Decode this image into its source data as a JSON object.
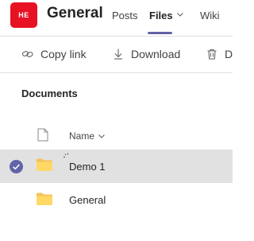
{
  "header": {
    "team_avatar_initials": "HE",
    "team_avatar_color": "#e81123",
    "channel_title": "General",
    "tabs": [
      {
        "label": "Posts",
        "active": false
      },
      {
        "label": "Files",
        "active": true,
        "has_dropdown": true
      },
      {
        "label": "Wiki",
        "active": false
      }
    ],
    "accent_color": "#6264a7"
  },
  "toolbar": {
    "copy_link": {
      "label": "Copy link",
      "icon": "link-icon"
    },
    "download": {
      "label": "Download",
      "icon": "download-icon"
    },
    "delete": {
      "label": "D",
      "icon": "trash-icon"
    }
  },
  "documents": {
    "section_title": "Documents",
    "columns": {
      "file_type_icon": "document-icon",
      "name": "Name",
      "name_sort_icon": "chevron-down-icon"
    },
    "rows": [
      {
        "name": "Demo 1",
        "type": "folder",
        "selected": true,
        "loading": true
      },
      {
        "name": "General",
        "type": "folder",
        "selected": false,
        "loading": false
      }
    ]
  }
}
